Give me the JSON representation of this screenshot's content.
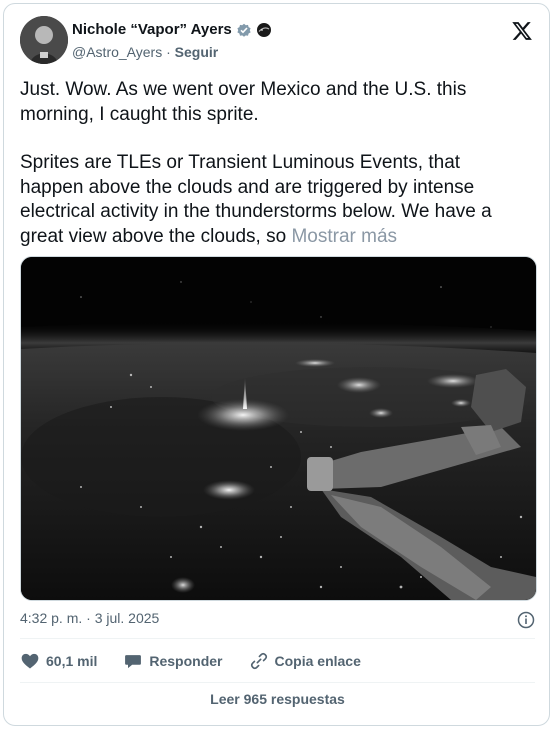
{
  "author": {
    "name": "Nichole “Vapor” Ayers",
    "handle": "@Astro_Ayers",
    "separator": "·",
    "follow_label": "Seguir",
    "badge_icon": "verified-gray-badge-icon",
    "affiliation_icon": "nasa-affiliation-icon"
  },
  "platform_icon": "x-logo-icon",
  "tweet": {
    "paragraph_1": "Just. Wow. As we went over Mexico and the U.S. this morning, I caught this sprite.",
    "paragraph_2": "Sprites are TLEs or Transient Luminous Events, that happen above the clouds and are triggered by intense electrical activity in the thunderstorms below. We have a great view above the clouds, so",
    "show_more": "Mostrar más"
  },
  "timestamp": "4:32 p. m. · 3 jul. 2025",
  "actions": {
    "likes": "60,1 mil",
    "reply": "Responder",
    "copy_link": "Copia enlace"
  },
  "read_replies": "Leer 965 respuestas",
  "colors": {
    "text": "#0f1419",
    "muted": "#536471",
    "border": "#cfd9de"
  }
}
